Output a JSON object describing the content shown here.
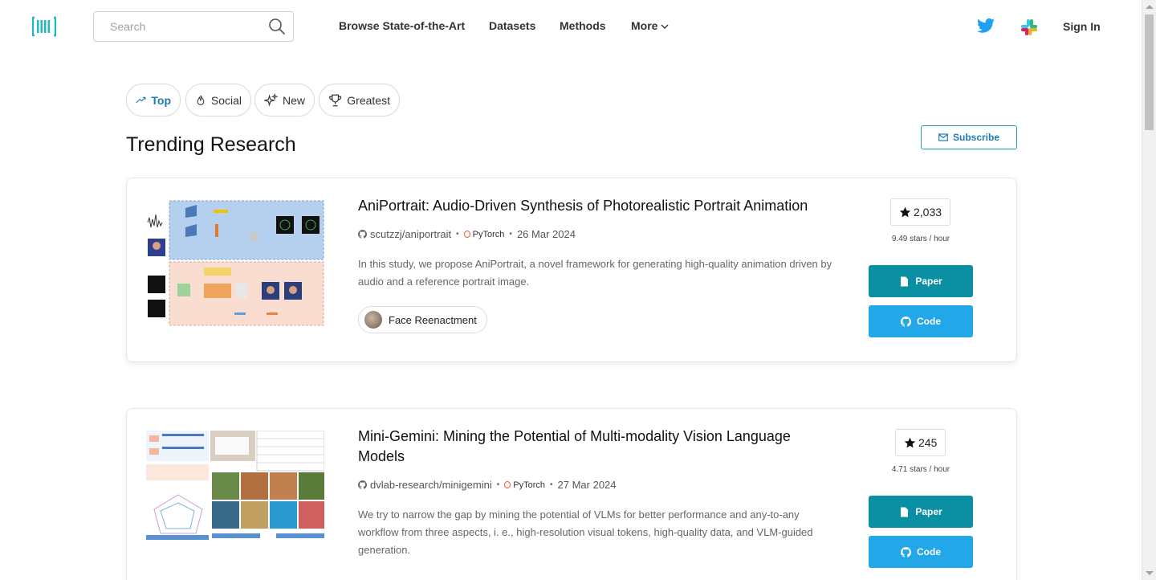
{
  "header": {
    "logo_icon": "paperswithcode-logo-icon",
    "search_placeholder": "Search",
    "nav": [
      "Browse State-of-the-Art",
      "Datasets",
      "Methods",
      "More"
    ],
    "sign_in": "Sign In"
  },
  "filters": [
    {
      "label": "Top",
      "icon": "trending-up-icon",
      "active": true
    },
    {
      "label": "Social",
      "icon": "flame-icon",
      "active": false
    },
    {
      "label": "New",
      "icon": "sparkles-icon",
      "active": false
    },
    {
      "label": "Greatest",
      "icon": "trophy-icon",
      "active": false
    }
  ],
  "page_title": "Trending Research",
  "subscribe_label": "Subscribe",
  "papers": [
    {
      "title": "AniPortrait: Audio-Driven Synthesis of Photorealistic Portrait Animation",
      "repo": "scutzzj/aniportrait",
      "framework": "PyTorch",
      "date": "26 Mar 2024",
      "abstract": "In this study, we propose AniPortrait, a novel framework for generating high-quality animation driven by audio and a reference portrait image.",
      "task": "Face Reenactment",
      "stars": "2,033",
      "rate": "9.49 stars / hour",
      "paper_label": "Paper",
      "code_label": "Code"
    },
    {
      "title": "Mini-Gemini: Mining the Potential of Multi-modality Vision Language Models",
      "repo": "dvlab-research/minigemini",
      "framework": "PyTorch",
      "date": "27 Mar 2024",
      "abstract": "We try to narrow the gap by mining the potential of VLMs for better performance and any-to-any workflow from three aspects, i. e., high-resolution visual tokens, high-quality data, and VLM-guided generation.",
      "stars": "245",
      "rate": "4.71 stars / hour",
      "paper_label": "Paper",
      "code_label": "Code"
    }
  ],
  "colors": {
    "brand": "#21b8c6",
    "paper_button": "#0b8fa3",
    "code_button": "#22a7e8",
    "active_filter": "#1f7bb5"
  }
}
